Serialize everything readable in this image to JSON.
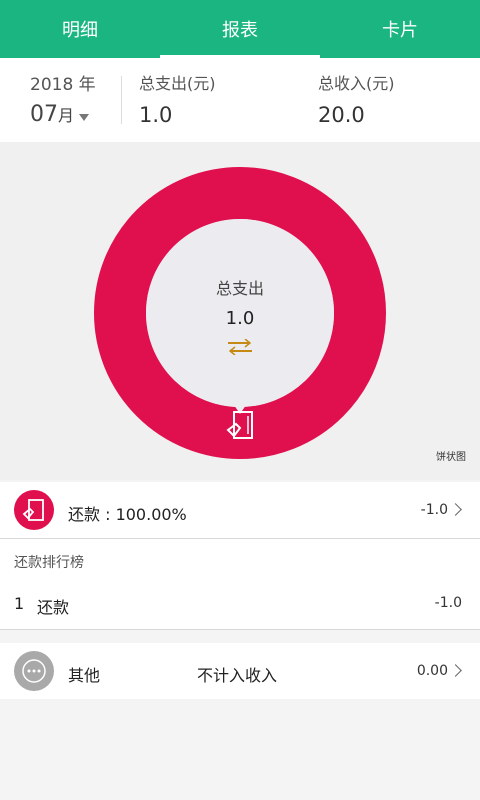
{
  "tabs": [
    {
      "label": "明细"
    },
    {
      "label": "报表"
    },
    {
      "label": "卡片"
    }
  ],
  "summary": {
    "year": "2018 年",
    "month_num": "07",
    "month_unit": "月",
    "expense_label": "总支出(元)",
    "expense_value": "1.0",
    "income_label": "总收入(元)",
    "income_value": "20.0"
  },
  "chart_data": {
    "type": "pie",
    "categories": [
      "还款"
    ],
    "values": [
      100.0
    ],
    "center_label": "总支出",
    "center_value": "1.0",
    "chart_type_label": "饼状图",
    "colors": [
      "#e0104f"
    ]
  },
  "category_row": {
    "label": "还款 : 100.00%",
    "amount": "-1.0",
    "icon": "repayment-card-icon",
    "icon_bg": "#e0104f"
  },
  "ranking": {
    "title": "还款排行榜",
    "items": [
      {
        "rank": "1",
        "name": "还款",
        "amount": "-1.0"
      }
    ]
  },
  "other_row": {
    "label": "其他",
    "note": "不计入收入",
    "amount": "0.00",
    "icon": "more-dots-icon",
    "icon_bg": "#a9a9a9"
  },
  "colors": {
    "accent": "#1ab580",
    "donut": "#e0104f",
    "swap_icon": "#c48a14"
  }
}
